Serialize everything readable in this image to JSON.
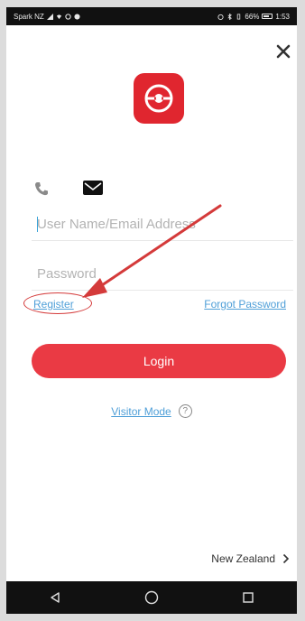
{
  "status_bar": {
    "carrier": "Spark NZ",
    "battery": "66%",
    "time": "1:53"
  },
  "login": {
    "username_placeholder": "User Name/Email Address",
    "password_placeholder": "Password",
    "register_label": "Register",
    "forgot_label": "Forgot Password",
    "login_label": "Login",
    "visitor_label": "Visitor Mode",
    "help_symbol": "?"
  },
  "region": {
    "label": "New Zealand"
  },
  "icons": {
    "close": "close-icon",
    "logo": "app-logo-icon",
    "phone": "phone-icon",
    "email": "envelope-icon",
    "help": "help-icon",
    "chevron": "chevron-right-icon",
    "nav_back": "back-triangle-icon",
    "nav_home": "home-circle-icon",
    "nav_recents": "recents-square-icon"
  },
  "colors": {
    "accent_red": "#ea3a44",
    "link_blue": "#4f9fd8",
    "annotation_red": "#d43a3a"
  }
}
